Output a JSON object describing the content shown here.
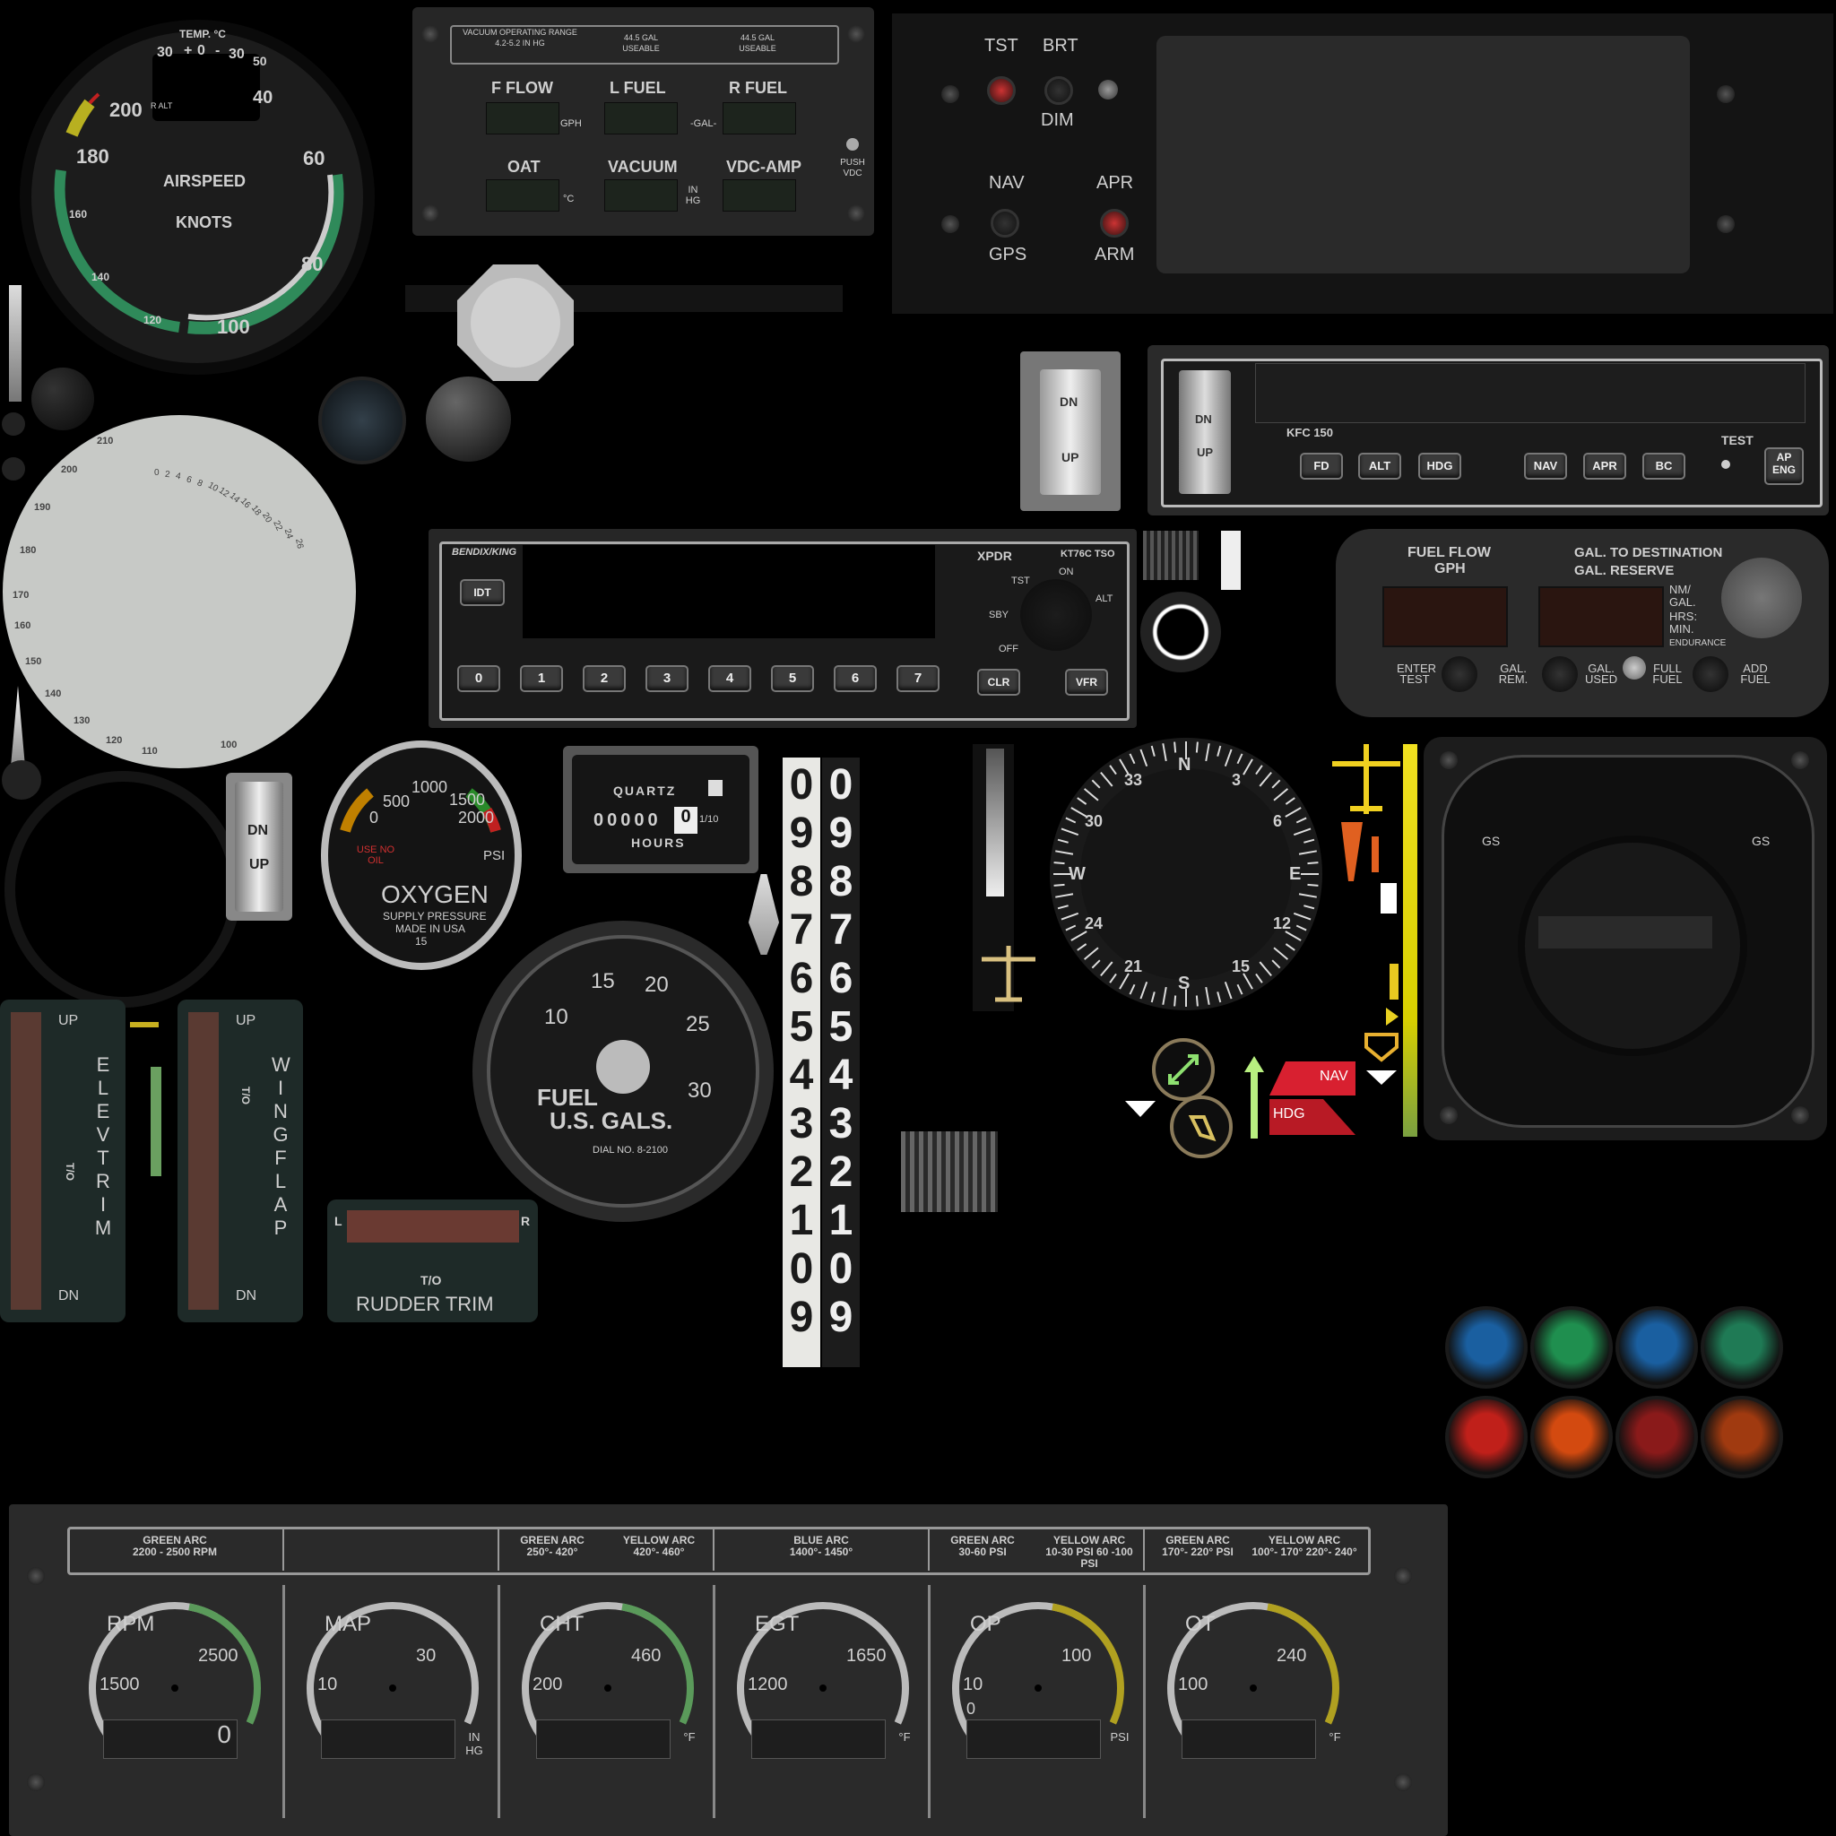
{
  "airspeed": {
    "temp_label": "TEMP. °C",
    "temp_scale": [
      "30",
      "+",
      "0",
      "-",
      "30",
      "50",
      "40"
    ],
    "title": "AIRSPEED",
    "unit": "KNOTS",
    "ticks": [
      "200",
      "180",
      "160",
      "140",
      "120",
      "100",
      "80",
      "60"
    ],
    "ralt_label": "R ALT"
  },
  "engine_info_panel": {
    "header": [
      "VACUUM OPERATING RANGE 4.2-5.2 IN HG",
      "44.5 GAL USEABLE",
      "44.5 GAL USEABLE"
    ],
    "row1": [
      "F FLOW",
      "L FUEL",
      "R FUEL"
    ],
    "row1_units": [
      "GPH",
      "-GAL-"
    ],
    "row2": [
      "OAT",
      "VACUUM",
      "VDC-AMP"
    ],
    "row2_units": [
      "°C",
      "IN HG"
    ],
    "push_vdc": "PUSH VDC"
  },
  "annunciator": {
    "tst": "TST",
    "brt": "BRT",
    "dim": "DIM",
    "nav": "NAV",
    "gps": "GPS",
    "apr": "APR",
    "arm": "ARM"
  },
  "switches": {
    "dn": "DN",
    "up": "UP"
  },
  "autopilot": {
    "model": "KFC 150",
    "buttons": [
      "FD",
      "ALT",
      "HDG",
      "NAV",
      "APR",
      "BC"
    ],
    "test": "TEST",
    "ap_eng": [
      "AP",
      "ENG"
    ]
  },
  "transponder": {
    "brand": "BENDIX/KING",
    "idt": "IDT",
    "xpdr": "XPDR",
    "model": "KT76C TSO",
    "modes": [
      "TST",
      "ON",
      "ALT",
      "SBY",
      "OFF"
    ],
    "digits": [
      "0",
      "1",
      "2",
      "3",
      "4",
      "5",
      "6",
      "7"
    ],
    "clr": "CLR",
    "vfr": "VFR"
  },
  "fuel_flow": {
    "title": "FUEL FLOW",
    "unit": "GPH",
    "dest": "GAL. TO DESTINATION",
    "reserve": "GAL. RESERVE",
    "modes": [
      "NM/",
      "GAL.",
      "HRS:",
      "MIN.",
      "ENDURANCE"
    ],
    "buttons": [
      "ENTER TEST",
      "GAL. REM.",
      "GAL. USED",
      "FULL FUEL",
      "ADD FUEL"
    ]
  },
  "compass_card": {
    "left_ticks": [
      "210",
      "200",
      "190",
      "180",
      "170",
      "160",
      "150",
      "140",
      "130",
      "120",
      "110",
      "100"
    ],
    "top_ticks": [
      "0",
      "2",
      "4",
      "6",
      "8",
      "10",
      "12",
      "14",
      "16",
      "18",
      "20",
      "22",
      "24",
      "26"
    ]
  },
  "oxygen": {
    "ticks": [
      "0",
      "500",
      "1000",
      "1500",
      "2000"
    ],
    "warning": "USE NO OIL",
    "unit": "PSI",
    "title": "OXYGEN",
    "sub1": "SUPPLY PRESSURE",
    "sub2": "MADE IN USA",
    "sub3": "15"
  },
  "hobbs": {
    "brand": "QUARTZ",
    "digits": "00000",
    "tenth_digit": "0",
    "fraction": "1/10",
    "unit": "HOURS"
  },
  "digit_strips": [
    "0",
    "9",
    "8",
    "7",
    "6",
    "5",
    "4",
    "3",
    "2",
    "1",
    "0",
    "9"
  ],
  "fuel_gauge": {
    "ticks": [
      "10",
      "15",
      "20",
      "25",
      "30"
    ],
    "title": "FUEL",
    "unit": "U.S. GALS.",
    "dial": "DIAL NO. 8-2100"
  },
  "heading_card": {
    "labels": [
      "N",
      "3",
      "6",
      "E",
      "12",
      "15",
      "S",
      "21",
      "24",
      "W",
      "30",
      "33"
    ]
  },
  "hsi": {
    "gs_left": "GS",
    "gs_right": "GS"
  },
  "hsi_flags": {
    "nav": "NAV",
    "hdg": "HDG"
  },
  "elev_trim": {
    "up": "UP",
    "dn": "DN",
    "title": "ELEV TRIM",
    "to": "T/O"
  },
  "wing_flap": {
    "up": "UP",
    "dn": "DN",
    "title": "WING FLAP",
    "to": "T/O"
  },
  "rudder_trim": {
    "l": "L",
    "r": "R",
    "to": "T/O",
    "title": "RUDDER TRIM"
  },
  "lights": {
    "top": [
      "#1a5fa0",
      "#1f8f4f",
      "#1a5fa0",
      "#1f7a55"
    ],
    "bottom": [
      "#c0201a",
      "#d34a10",
      "#8a1a1a",
      "#a03a10"
    ]
  },
  "engine_panel": {
    "header": [
      [
        "GREEN ARC",
        "2200 - 2500 RPM"
      ],
      [
        "",
        ""
      ],
      [
        "GREEN ARC",
        "250°- 420°"
      ],
      [
        "YELLOW ARC",
        "420°- 460°"
      ],
      [
        "BLUE ARC",
        "1400°- 1450°"
      ],
      [
        "GREEN ARC",
        "30-60 PSI"
      ],
      [
        "YELLOW ARC",
        "10-30 PSI 60 -100 PSI"
      ],
      [
        "GREEN ARC",
        "170°- 220° PSI"
      ],
      [
        "YELLOW ARC",
        "100°- 170° 220°- 240°"
      ]
    ],
    "gauges": [
      {
        "name": "RPM",
        "lo": "1500",
        "hi": "2500",
        "unit": "",
        "readout": "0",
        "arc": "#5a9a5a"
      },
      {
        "name": "MAP",
        "lo": "10",
        "hi": "30",
        "unit": "IN HG",
        "readout": "",
        "arc": "#bbbbbb"
      },
      {
        "name": "CHT",
        "lo": "200",
        "hi": "460",
        "unit": "°F",
        "readout": "",
        "arc": "#5a9a5a"
      },
      {
        "name": "EGT",
        "lo": "1200",
        "hi": "1650",
        "unit": "°F",
        "readout": "",
        "arc": "#bbbbbb"
      },
      {
        "name": "OP",
        "lo": "10",
        "lo2": "0",
        "hi": "100",
        "unit": "PSI",
        "readout": "",
        "arc": "#b0a020"
      },
      {
        "name": "OT",
        "lo": "100",
        "hi": "240",
        "unit": "°F",
        "readout": "",
        "arc": "#b0a020"
      }
    ]
  }
}
